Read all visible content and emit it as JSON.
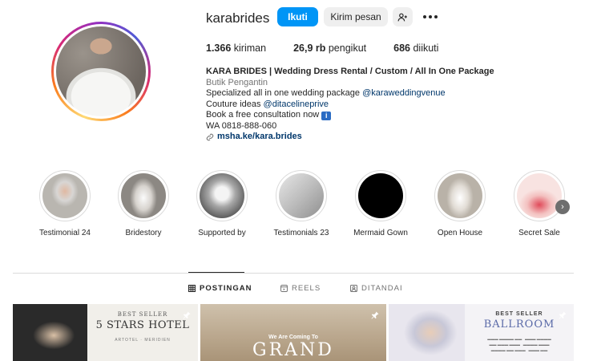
{
  "profile": {
    "username": "karabrides",
    "follow_label": "Ikuti",
    "message_label": "Kirim pesan",
    "stats": {
      "posts_value": "1.366",
      "posts_label": "kiriman",
      "followers_value": "26,9 rb",
      "followers_label": "pengikut",
      "following_value": "686",
      "following_label": "diikuti"
    },
    "bio": {
      "title": "KARA BRIDES | Wedding Dress Rental / Custom / All In One Package",
      "category": "Butik Pengantin",
      "line1_text": "Specialized all in one wedding package ",
      "line1_tag": "@karaweddingvenue",
      "line2_text": "Couture ideas ",
      "line2_tag": "@ditacelineprive",
      "line3_text": "Book a free consultation now ",
      "line4": "WA 0818-888-060",
      "link": "msha.ke/kara.brides"
    }
  },
  "highlights": [
    {
      "label": "Testimonial 24"
    },
    {
      "label": "Bridestory"
    },
    {
      "label": "Supported by"
    },
    {
      "label": "Testimonials 23"
    },
    {
      "label": "Mermaid Gown"
    },
    {
      "label": "Open House"
    },
    {
      "label": "Secret Sale"
    }
  ],
  "tabs": [
    {
      "label": "POSTINGAN"
    },
    {
      "label": "REELS"
    },
    {
      "label": "DITANDAI"
    }
  ],
  "posts": [
    {
      "best": "BEST SELLER",
      "heading": "5 STARS HOTEL",
      "sub": "ARTOTEL  ·  MERIDIEN"
    },
    {
      "small": "We Are Coming To",
      "big": "GRAND"
    },
    {
      "best": "BEST SELLER",
      "heading": "BALLROOM"
    }
  ],
  "colors": {
    "accent": "#0095f6",
    "link": "#00376b"
  }
}
